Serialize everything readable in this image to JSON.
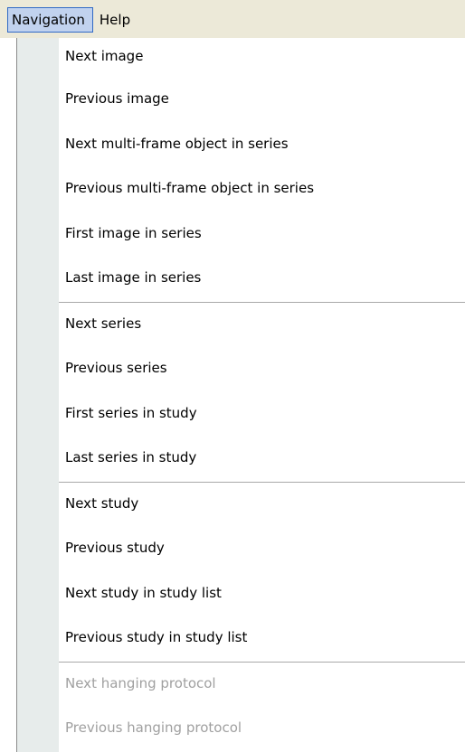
{
  "menubar": {
    "items": [
      {
        "label": "Navigation"
      },
      {
        "label": "Help"
      }
    ]
  },
  "menu": {
    "groups": [
      {
        "items": [
          {
            "label": "Next image",
            "enabled": true
          },
          {
            "label": "Previous image",
            "enabled": true
          },
          {
            "label": "Next multi-frame object in series",
            "enabled": true
          },
          {
            "label": "Previous multi-frame object in series",
            "enabled": true
          },
          {
            "label": "First image in series",
            "enabled": true
          },
          {
            "label": "Last image in series",
            "enabled": true
          }
        ]
      },
      {
        "items": [
          {
            "label": "Next series",
            "enabled": true
          },
          {
            "label": "Previous series",
            "enabled": true
          },
          {
            "label": "First series in study",
            "enabled": true
          },
          {
            "label": "Last series in study",
            "enabled": true
          }
        ]
      },
      {
        "items": [
          {
            "label": "Next study",
            "enabled": true
          },
          {
            "label": "Previous study",
            "enabled": true
          },
          {
            "label": "Next study in study list",
            "enabled": true
          },
          {
            "label": "Previous study in study list",
            "enabled": true
          }
        ]
      },
      {
        "items": [
          {
            "label": "Next hanging protocol",
            "enabled": false
          },
          {
            "label": "Previous hanging protocol",
            "enabled": false
          }
        ]
      }
    ]
  },
  "colors": {
    "menubar_bg": "#ECE9D8",
    "active_item_bg": "#C1D2EE",
    "active_item_border": "#316AC5",
    "gutter_bg": "#E7ECEB",
    "disabled_text": "#A0A0A0",
    "separator": "#A8A8A8"
  }
}
